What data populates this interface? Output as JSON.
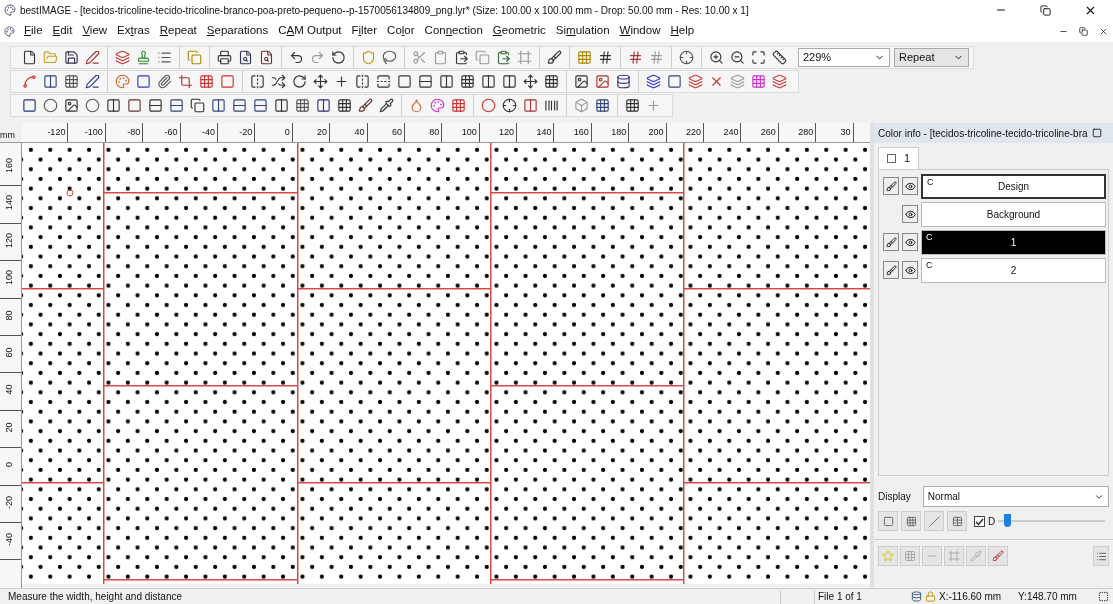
{
  "window": {
    "title": "bestIMAGE - [tecidos-tricoline-tecido-tricoline-branco-poa-preto-pequeno--p-1570056134809_png.lyr* (Size: 100.00 x 100.00 mm - Drop: 50.00 mm - Res: 10.00 x 1]"
  },
  "menu": [
    "File",
    "Edit",
    "View",
    "Extras",
    "Repeat",
    "Separations",
    "CAM Output",
    "Filter",
    "Color",
    "Connection",
    "Geometric",
    "Simulation",
    "Window",
    "Help"
  ],
  "toolbar": {
    "zoom": "229%",
    "mode": "Repeat"
  },
  "ruler": {
    "unit": "mm",
    "x_labels": [
      "-120",
      "-100",
      "-80",
      "-60",
      "-40",
      "-20",
      "0",
      "20",
      "40",
      "60",
      "80",
      "100",
      "120",
      "140",
      "160",
      "180",
      "200",
      "220",
      "240",
      "260",
      "280",
      "30"
    ],
    "y_labels": [
      "160",
      "140",
      "120",
      "100",
      "80",
      "60",
      "40",
      "20",
      "0",
      "-20",
      "-40"
    ]
  },
  "color_info": {
    "title": "Color info - [tecidos-tricoline-tecido-tricoline-bra",
    "tab": {
      "label": "1",
      "checked": false
    },
    "layers": [
      {
        "name": "Design",
        "mark": "C",
        "editable": true,
        "color": "#ffffff",
        "selected": true
      },
      {
        "name": "Background",
        "editable": false,
        "color": "#ffffff",
        "selected": false
      },
      {
        "name": "1",
        "mark": "C",
        "editable": true,
        "color": "#000000",
        "selected": false
      },
      {
        "name": "2",
        "mark": "C",
        "editable": true,
        "color": "#ffffff",
        "selected": false
      }
    ],
    "display_label": "Display",
    "display": "Normal",
    "option": {
      "label": "D",
      "checked": true,
      "level": 0.05
    }
  },
  "status_bar": {
    "message": "Measure the width, height and distance",
    "file": "File 1 of 1",
    "x": "X:-116.60 mm",
    "y": "Y:148.70 mm"
  }
}
